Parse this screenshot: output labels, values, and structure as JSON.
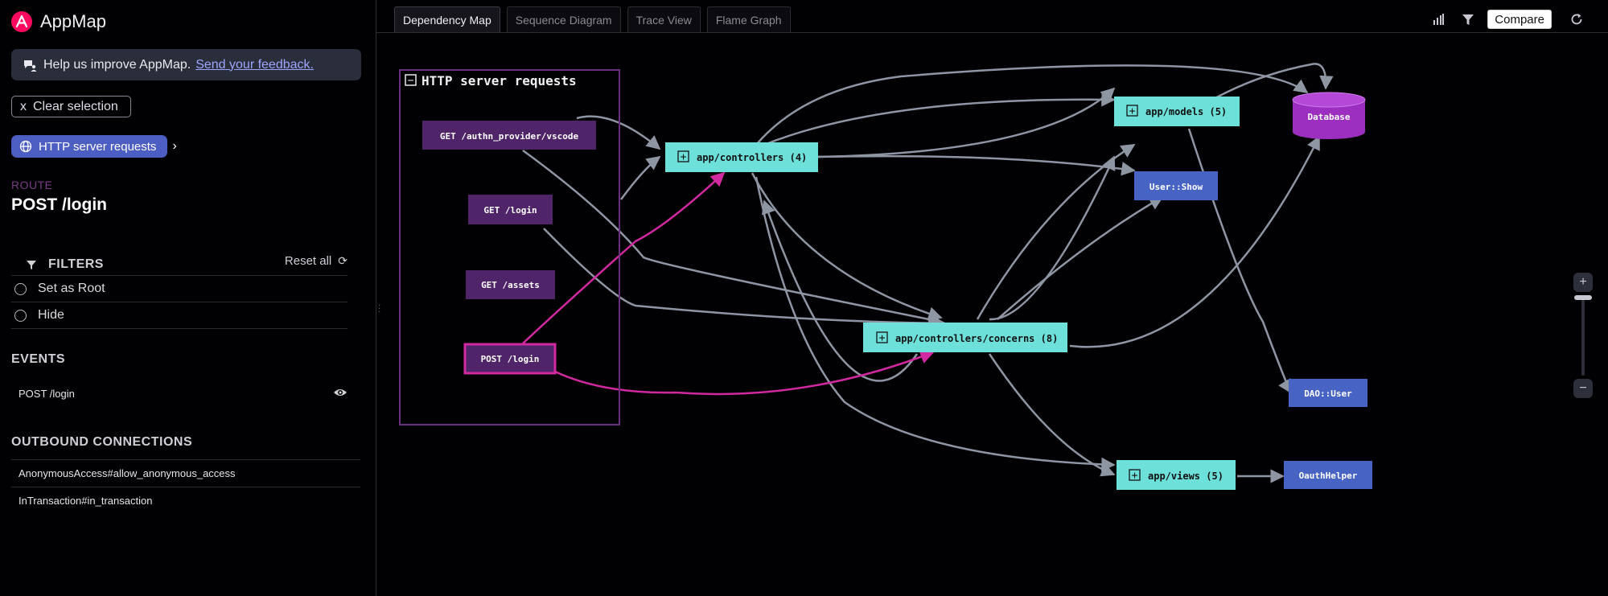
{
  "brand": {
    "title": "AppMap"
  },
  "feedback": {
    "text": "Help us improve AppMap.",
    "link": "Send your feedback."
  },
  "selection": {
    "clear_label": "x",
    "clear_text": "Clear selection"
  },
  "breadcrumb": {
    "label": "HTTP server requests",
    "arrow": "›"
  },
  "route": {
    "label": "ROUTE",
    "title": "POST /login"
  },
  "filters": {
    "title": "FILTERS",
    "reset": "Reset all",
    "options": [
      "Set as Root",
      "Hide"
    ]
  },
  "events": {
    "title": "EVENTS",
    "items": [
      "POST /login"
    ]
  },
  "outbound": {
    "title": "OUTBOUND CONNECTIONS",
    "items": [
      "AnonymousAccess#allow_anonymous_access",
      "InTransaction#in_transaction"
    ]
  },
  "tabs": [
    "Dependency Map",
    "Sequence Diagram",
    "Trace View",
    "Flame Graph"
  ],
  "toolbar": {
    "compare": "Compare"
  },
  "graph": {
    "cluster_title": "HTTP server requests",
    "cluster_toggle": "−",
    "expand_glyph": "+",
    "nodes": {
      "get_authn": "GET /authn_provider/vscode",
      "get_login": "GET /login",
      "get_assets": "GET /assets",
      "post_login": "POST /login",
      "controllers": "app/controllers (4)",
      "concerns": "app/controllers/concerns (8)",
      "models": "app/models (5)",
      "views": "app/views (5)",
      "user_show": "User::Show",
      "dao_user": "DAO::User",
      "oauth_helper": "OauthHelper",
      "database": "Database"
    }
  },
  "zoom": {
    "in": "+",
    "out": "−"
  },
  "colors": {
    "request": "#4f2468",
    "package": "#6ee0da",
    "class": "#4764c5",
    "database": "#9c2fbf",
    "edge": "#8f96a3",
    "highlight": "#d1299f"
  }
}
